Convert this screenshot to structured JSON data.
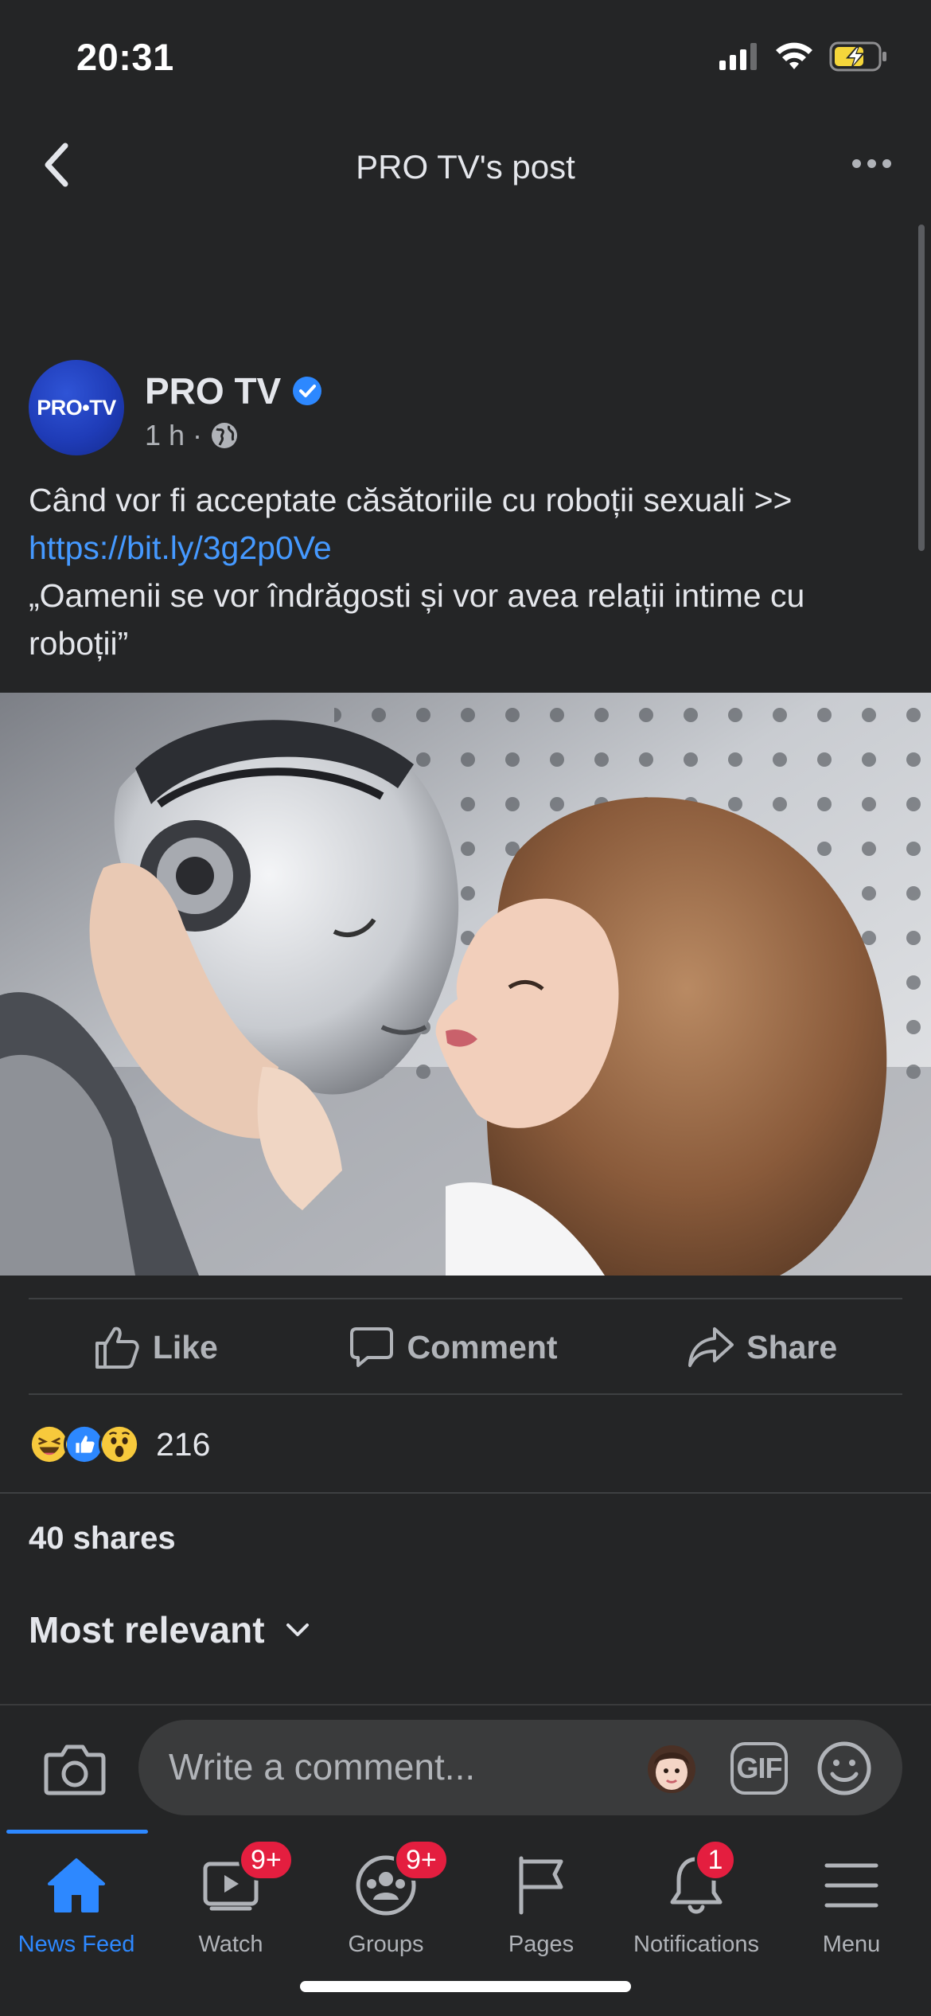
{
  "status_bar": {
    "time": "20:31"
  },
  "header": {
    "title": "PRO TV's post"
  },
  "post": {
    "page_name": "PRO TV",
    "avatar_text": "PRO•TV",
    "time_ago": "1 h",
    "separator": "·",
    "text_line_1": "Când vor fi acceptate căsătoriile cu roboții sexuali >>",
    "link": "https://bit.ly/3g2p0Ve",
    "text_line_2": "„Oamenii se vor îndrăgosti și vor avea relații intime cu roboții”",
    "image_icon": "robot-woman-photo"
  },
  "actions": {
    "like": "Like",
    "comment": "Comment",
    "share": "Share"
  },
  "reactions": {
    "icons": [
      "haha-reaction-icon",
      "like-reaction-icon",
      "wow-reaction-icon"
    ],
    "count": "216"
  },
  "shares_text": "40 shares",
  "sort_label": "Most relevant",
  "composer": {
    "placeholder": "Write a comment...",
    "gif_label": "GIF"
  },
  "tabs": [
    {
      "label": "News Feed",
      "active": true
    },
    {
      "label": "Watch",
      "badge": "9+"
    },
    {
      "label": "Groups",
      "badge": "9+"
    },
    {
      "label": "Pages"
    },
    {
      "label": "Notifications",
      "badge": "1"
    },
    {
      "label": "Menu"
    }
  ],
  "colors": {
    "background": "#242526",
    "accent": "#2d88ff",
    "link": "#4599ff",
    "badge": "#e41e3f",
    "battery": "#f5d63b"
  }
}
